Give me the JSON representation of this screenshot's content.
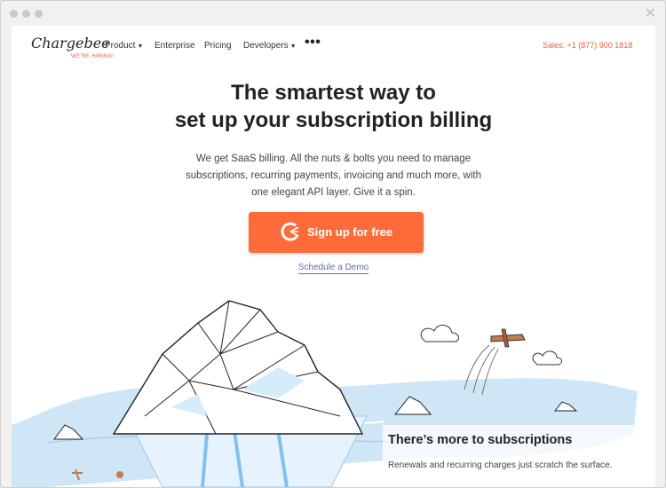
{
  "window": {
    "controls": [
      "close-dot",
      "minimize-dot",
      "zoom-dot"
    ],
    "close_glyph": "✕"
  },
  "nav": {
    "logo": "Chargebee",
    "hiring": "WE'RE HIRING!",
    "items": [
      {
        "label": "Product",
        "has_dropdown": true
      },
      {
        "label": "Enterprise",
        "has_dropdown": false
      },
      {
        "label": "Pricing",
        "has_dropdown": false
      },
      {
        "label": "Developers",
        "has_dropdown": true
      }
    ],
    "more": "•••",
    "sales": "Sales: +1 (877) 900 1818"
  },
  "hero": {
    "headline_line1": "The smartest way to",
    "headline_line2": "set up your subscription billing",
    "sub_line1": "We get SaaS billing. All the nuts & bolts you need to manage",
    "sub_line2": "subscriptions, recurring payments, invoicing and much more, with",
    "sub_line3": "one elegant API layer. Give it a spin.",
    "cta_label": "Sign up for free",
    "demo_label": "Schedule a Demo"
  },
  "section": {
    "title": "There’s more to subscriptions",
    "text": "Renewals and recurring charges just scratch the surface."
  },
  "colors": {
    "accent": "#fe6b3a",
    "sales": "#f05d3b",
    "link": "#5a6fb5",
    "water": "#cfe6f7"
  },
  "icons": {
    "cta": "chargebee-logo-icon",
    "dropdown": "caret-down-icon",
    "more": "more-dots-icon"
  }
}
